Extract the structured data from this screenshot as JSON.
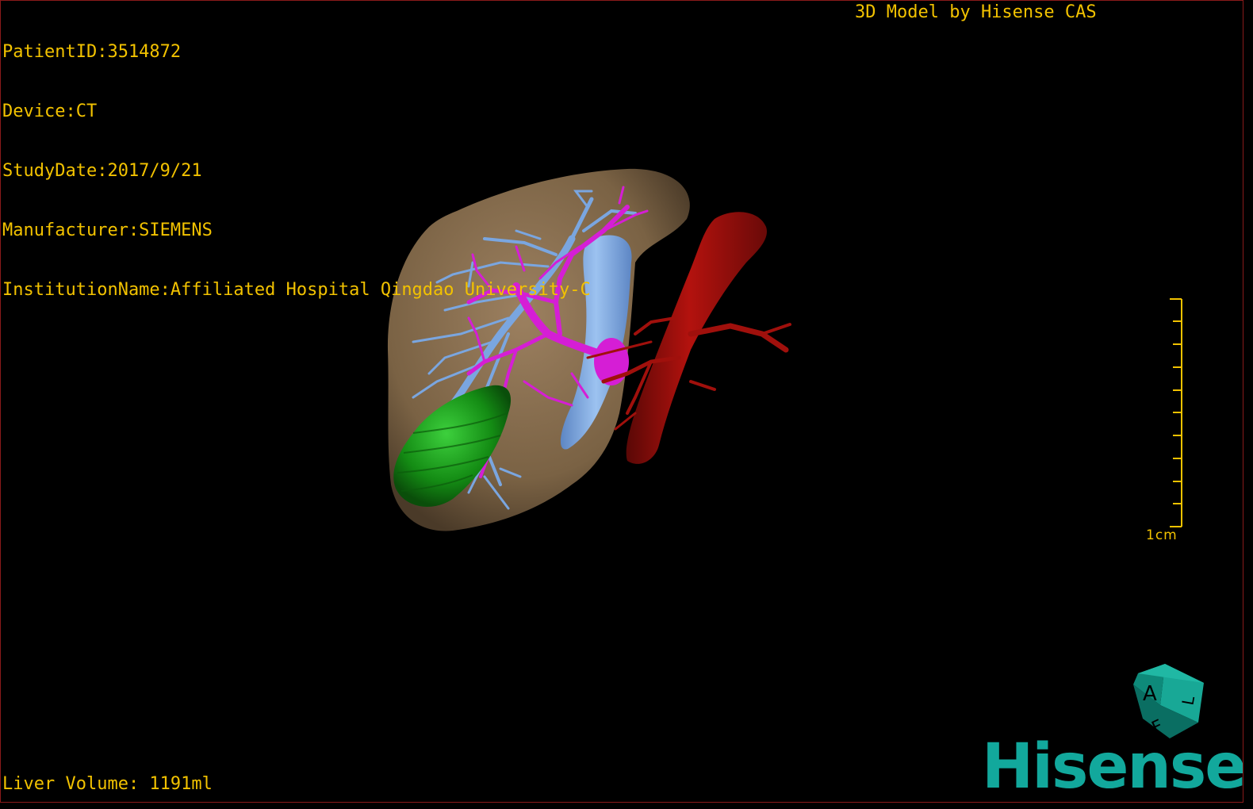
{
  "header": {
    "patient_id": "PatientID:3514872",
    "device": "Device:CT",
    "study_date": "StudyDate:2017/9/21",
    "manufacturer": "Manufacturer:SIEMENS",
    "institution": "InstitutionName:Affiliated Hospital Qingdao University-C"
  },
  "brand_line": "3D Model by Hisense CAS",
  "footer": {
    "liver_volume": "Liver Volume: 1191ml"
  },
  "scale_bar": {
    "label": "1cm"
  },
  "orientation_cube": {
    "faces": [
      "A",
      "F",
      "L"
    ]
  },
  "logo": "Hisense",
  "colors": {
    "overlay_text": "#f2c200",
    "liver": "#8a7050",
    "portal_vein": "#7aa6e0",
    "hepatic_vein": "#d51ed5",
    "artery": "#a0100c",
    "gallbladder": "#1a9a1a",
    "logo": "#12a89c",
    "frame": "#8a1a1a"
  }
}
